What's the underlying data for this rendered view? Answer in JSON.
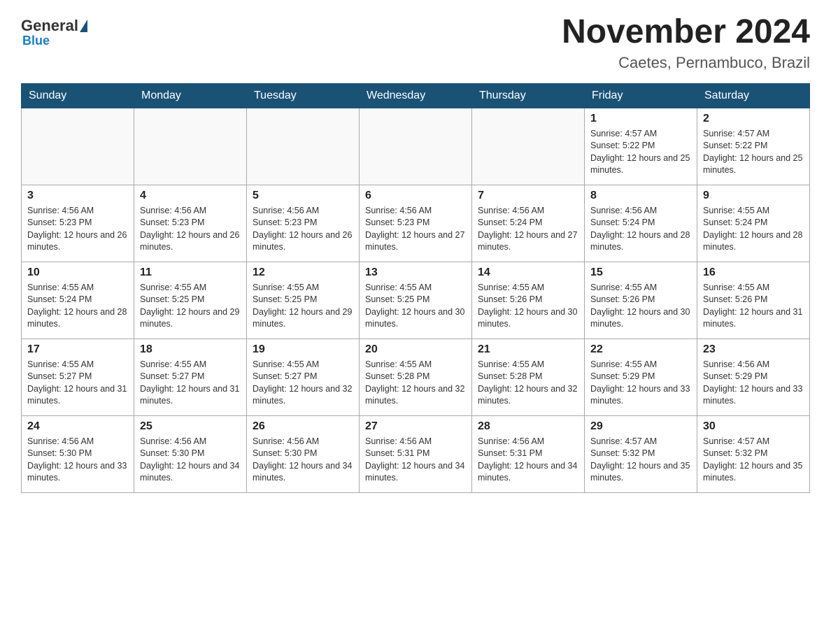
{
  "header": {
    "logo": {
      "general": "General",
      "blue": "Blue"
    },
    "title": "November 2024",
    "location": "Caetes, Pernambuco, Brazil"
  },
  "days_of_week": [
    "Sunday",
    "Monday",
    "Tuesday",
    "Wednesday",
    "Thursday",
    "Friday",
    "Saturday"
  ],
  "weeks": [
    [
      {
        "day": "",
        "info": ""
      },
      {
        "day": "",
        "info": ""
      },
      {
        "day": "",
        "info": ""
      },
      {
        "day": "",
        "info": ""
      },
      {
        "day": "",
        "info": ""
      },
      {
        "day": "1",
        "info": "Sunrise: 4:57 AM\nSunset: 5:22 PM\nDaylight: 12 hours and 25 minutes."
      },
      {
        "day": "2",
        "info": "Sunrise: 4:57 AM\nSunset: 5:22 PM\nDaylight: 12 hours and 25 minutes."
      }
    ],
    [
      {
        "day": "3",
        "info": "Sunrise: 4:56 AM\nSunset: 5:23 PM\nDaylight: 12 hours and 26 minutes."
      },
      {
        "day": "4",
        "info": "Sunrise: 4:56 AM\nSunset: 5:23 PM\nDaylight: 12 hours and 26 minutes."
      },
      {
        "day": "5",
        "info": "Sunrise: 4:56 AM\nSunset: 5:23 PM\nDaylight: 12 hours and 26 minutes."
      },
      {
        "day": "6",
        "info": "Sunrise: 4:56 AM\nSunset: 5:23 PM\nDaylight: 12 hours and 27 minutes."
      },
      {
        "day": "7",
        "info": "Sunrise: 4:56 AM\nSunset: 5:24 PM\nDaylight: 12 hours and 27 minutes."
      },
      {
        "day": "8",
        "info": "Sunrise: 4:56 AM\nSunset: 5:24 PM\nDaylight: 12 hours and 28 minutes."
      },
      {
        "day": "9",
        "info": "Sunrise: 4:55 AM\nSunset: 5:24 PM\nDaylight: 12 hours and 28 minutes."
      }
    ],
    [
      {
        "day": "10",
        "info": "Sunrise: 4:55 AM\nSunset: 5:24 PM\nDaylight: 12 hours and 28 minutes."
      },
      {
        "day": "11",
        "info": "Sunrise: 4:55 AM\nSunset: 5:25 PM\nDaylight: 12 hours and 29 minutes."
      },
      {
        "day": "12",
        "info": "Sunrise: 4:55 AM\nSunset: 5:25 PM\nDaylight: 12 hours and 29 minutes."
      },
      {
        "day": "13",
        "info": "Sunrise: 4:55 AM\nSunset: 5:25 PM\nDaylight: 12 hours and 30 minutes."
      },
      {
        "day": "14",
        "info": "Sunrise: 4:55 AM\nSunset: 5:26 PM\nDaylight: 12 hours and 30 minutes."
      },
      {
        "day": "15",
        "info": "Sunrise: 4:55 AM\nSunset: 5:26 PM\nDaylight: 12 hours and 30 minutes."
      },
      {
        "day": "16",
        "info": "Sunrise: 4:55 AM\nSunset: 5:26 PM\nDaylight: 12 hours and 31 minutes."
      }
    ],
    [
      {
        "day": "17",
        "info": "Sunrise: 4:55 AM\nSunset: 5:27 PM\nDaylight: 12 hours and 31 minutes."
      },
      {
        "day": "18",
        "info": "Sunrise: 4:55 AM\nSunset: 5:27 PM\nDaylight: 12 hours and 31 minutes."
      },
      {
        "day": "19",
        "info": "Sunrise: 4:55 AM\nSunset: 5:27 PM\nDaylight: 12 hours and 32 minutes."
      },
      {
        "day": "20",
        "info": "Sunrise: 4:55 AM\nSunset: 5:28 PM\nDaylight: 12 hours and 32 minutes."
      },
      {
        "day": "21",
        "info": "Sunrise: 4:55 AM\nSunset: 5:28 PM\nDaylight: 12 hours and 32 minutes."
      },
      {
        "day": "22",
        "info": "Sunrise: 4:55 AM\nSunset: 5:29 PM\nDaylight: 12 hours and 33 minutes."
      },
      {
        "day": "23",
        "info": "Sunrise: 4:56 AM\nSunset: 5:29 PM\nDaylight: 12 hours and 33 minutes."
      }
    ],
    [
      {
        "day": "24",
        "info": "Sunrise: 4:56 AM\nSunset: 5:30 PM\nDaylight: 12 hours and 33 minutes."
      },
      {
        "day": "25",
        "info": "Sunrise: 4:56 AM\nSunset: 5:30 PM\nDaylight: 12 hours and 34 minutes."
      },
      {
        "day": "26",
        "info": "Sunrise: 4:56 AM\nSunset: 5:30 PM\nDaylight: 12 hours and 34 minutes."
      },
      {
        "day": "27",
        "info": "Sunrise: 4:56 AM\nSunset: 5:31 PM\nDaylight: 12 hours and 34 minutes."
      },
      {
        "day": "28",
        "info": "Sunrise: 4:56 AM\nSunset: 5:31 PM\nDaylight: 12 hours and 34 minutes."
      },
      {
        "day": "29",
        "info": "Sunrise: 4:57 AM\nSunset: 5:32 PM\nDaylight: 12 hours and 35 minutes."
      },
      {
        "day": "30",
        "info": "Sunrise: 4:57 AM\nSunset: 5:32 PM\nDaylight: 12 hours and 35 minutes."
      }
    ]
  ]
}
